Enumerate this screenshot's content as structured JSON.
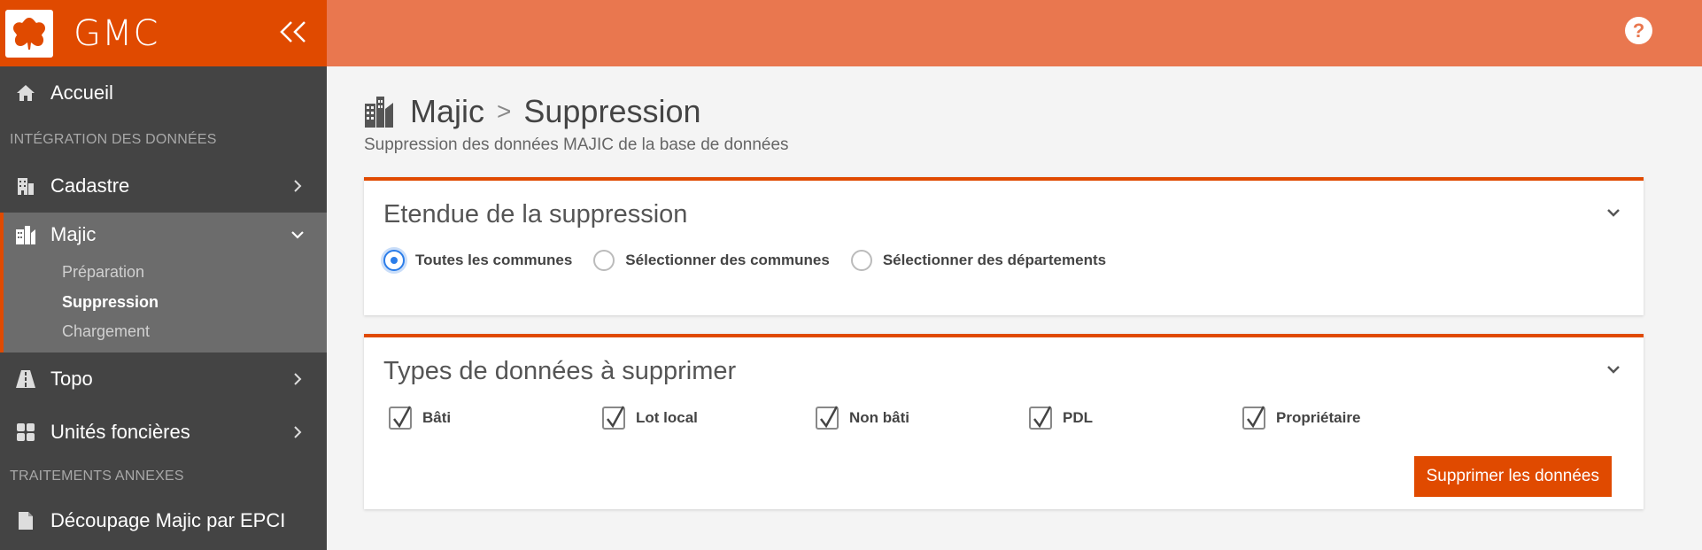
{
  "app": {
    "name": "GMC",
    "brand_color": "#e04a00",
    "topbar_color": "#e9774f"
  },
  "sidebar": {
    "items": [
      {
        "label": "Accueil",
        "icon": "home-icon"
      },
      {
        "section": "INTÉGRATION DES DONNÉES"
      },
      {
        "label": "Cadastre",
        "icon": "building-icon"
      },
      {
        "label": "Majic",
        "icon": "city-icon",
        "expanded": true,
        "children": [
          {
            "label": "Préparation"
          },
          {
            "label": "Suppression",
            "active": true
          },
          {
            "label": "Chargement"
          }
        ]
      },
      {
        "label": "Topo",
        "icon": "road-icon"
      },
      {
        "label": "Unités foncières",
        "icon": "grid-icon"
      },
      {
        "section": "TRAITEMENTS ANNEXES"
      },
      {
        "label": "Découpage Majic par EPCI",
        "icon": "file-icon"
      }
    ]
  },
  "topbar": {
    "help_label": "?"
  },
  "page": {
    "title": "Majic",
    "separator": ">",
    "subtitle_title": "Suppression",
    "description": "Suppression des données MAJIC de la base de données"
  },
  "scope_card": {
    "title": "Etendue de la suppression",
    "options": [
      {
        "label": "Toutes les communes",
        "checked": true
      },
      {
        "label": "Sélectionner des communes",
        "checked": false
      },
      {
        "label": "Sélectionner des départements",
        "checked": false
      }
    ]
  },
  "types_card": {
    "title": "Types de données à supprimer",
    "options": [
      {
        "label": "Bâti",
        "checked": true
      },
      {
        "label": "Lot local",
        "checked": true
      },
      {
        "label": "Non bâti",
        "checked": true
      },
      {
        "label": "PDL",
        "checked": true
      },
      {
        "label": "Propriétaire",
        "checked": true
      }
    ],
    "submit_label": "Supprimer les données"
  }
}
